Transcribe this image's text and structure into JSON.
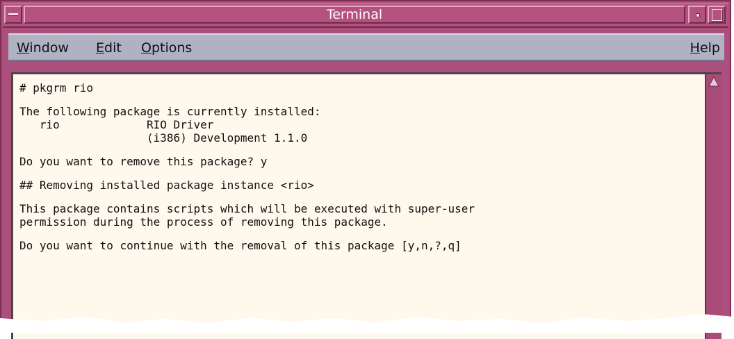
{
  "window": {
    "title": "Terminal"
  },
  "menubar": {
    "window_label": "Window",
    "window_mnemonic": "W",
    "window_rest": "indow",
    "edit_mnemonic": "E",
    "edit_rest": "dit",
    "options_mnemonic": "O",
    "options_rest": "ptions",
    "help_mnemonic": "H",
    "help_rest": "elp"
  },
  "terminal": {
    "lines": [
      "# pkgrm rio",
      "",
      "The following package is currently installed:",
      "   rio             RIO Driver",
      "                   (i386) Development 1.1.0",
      "",
      "Do you want to remove this package? y",
      "",
      "## Removing installed package instance <rio>",
      "",
      "This package contains scripts which will be executed with super-user",
      "permission during the process of removing this package.",
      "",
      "Do you want to continue with the removal of this package [y,n,?,q]"
    ]
  },
  "colors": {
    "title_bar": "#b5517f",
    "menubar": "#aeb2c3",
    "terminal_bg": "#fff8ec"
  },
  "icons": [
    "window-menu-icon",
    "minimize-icon",
    "maximize-icon",
    "scroll-up-arrow-icon"
  ]
}
